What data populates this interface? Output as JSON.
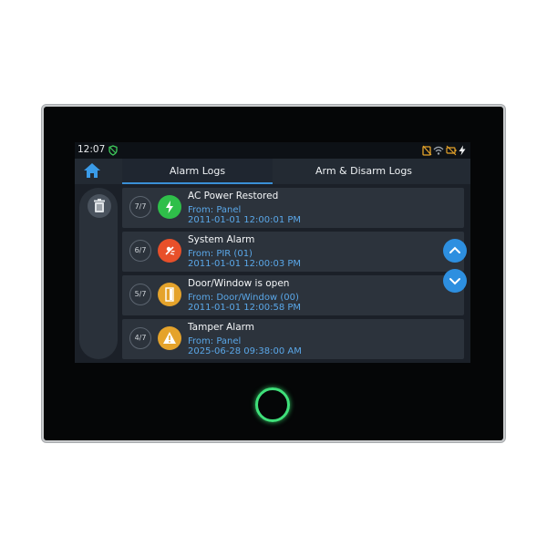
{
  "status": {
    "time": "12:07",
    "icons": [
      "shield-ok-icon",
      "tamper-icon",
      "wifi-icon",
      "battery-icon",
      "ac-power-icon"
    ]
  },
  "tabs": [
    {
      "label": "Alarm Logs",
      "active": true
    },
    {
      "label": "Arm & Disarm Logs",
      "active": false
    }
  ],
  "logs": [
    {
      "index": "7/7",
      "title": "AC Power Restored",
      "from": "From: Panel",
      "timestamp": "2011-01-01 12:00:01 PM",
      "color": "#2fbf4a",
      "icon": "bolt-icon"
    },
    {
      "index": "6/7",
      "title": "System Alarm",
      "from": "From: PIR (01)",
      "timestamp": "2011-01-01 12:00:03 PM",
      "color": "#e8502a",
      "icon": "alarm-icon"
    },
    {
      "index": "5/7",
      "title": "Door/Window is open",
      "from": "From: Door/Window (00)",
      "timestamp": "2011-01-01 12:00:58 PM",
      "color": "#e5a32b",
      "icon": "door-icon"
    },
    {
      "index": "4/7",
      "title": "Tamper Alarm",
      "from": "From: Panel",
      "timestamp": "2025-06-28 09:38:00 AM",
      "color": "#e5a32b",
      "icon": "warning-icon"
    }
  ],
  "colors": {
    "accent": "#2d8fe0",
    "ring": "#3fe07a"
  }
}
